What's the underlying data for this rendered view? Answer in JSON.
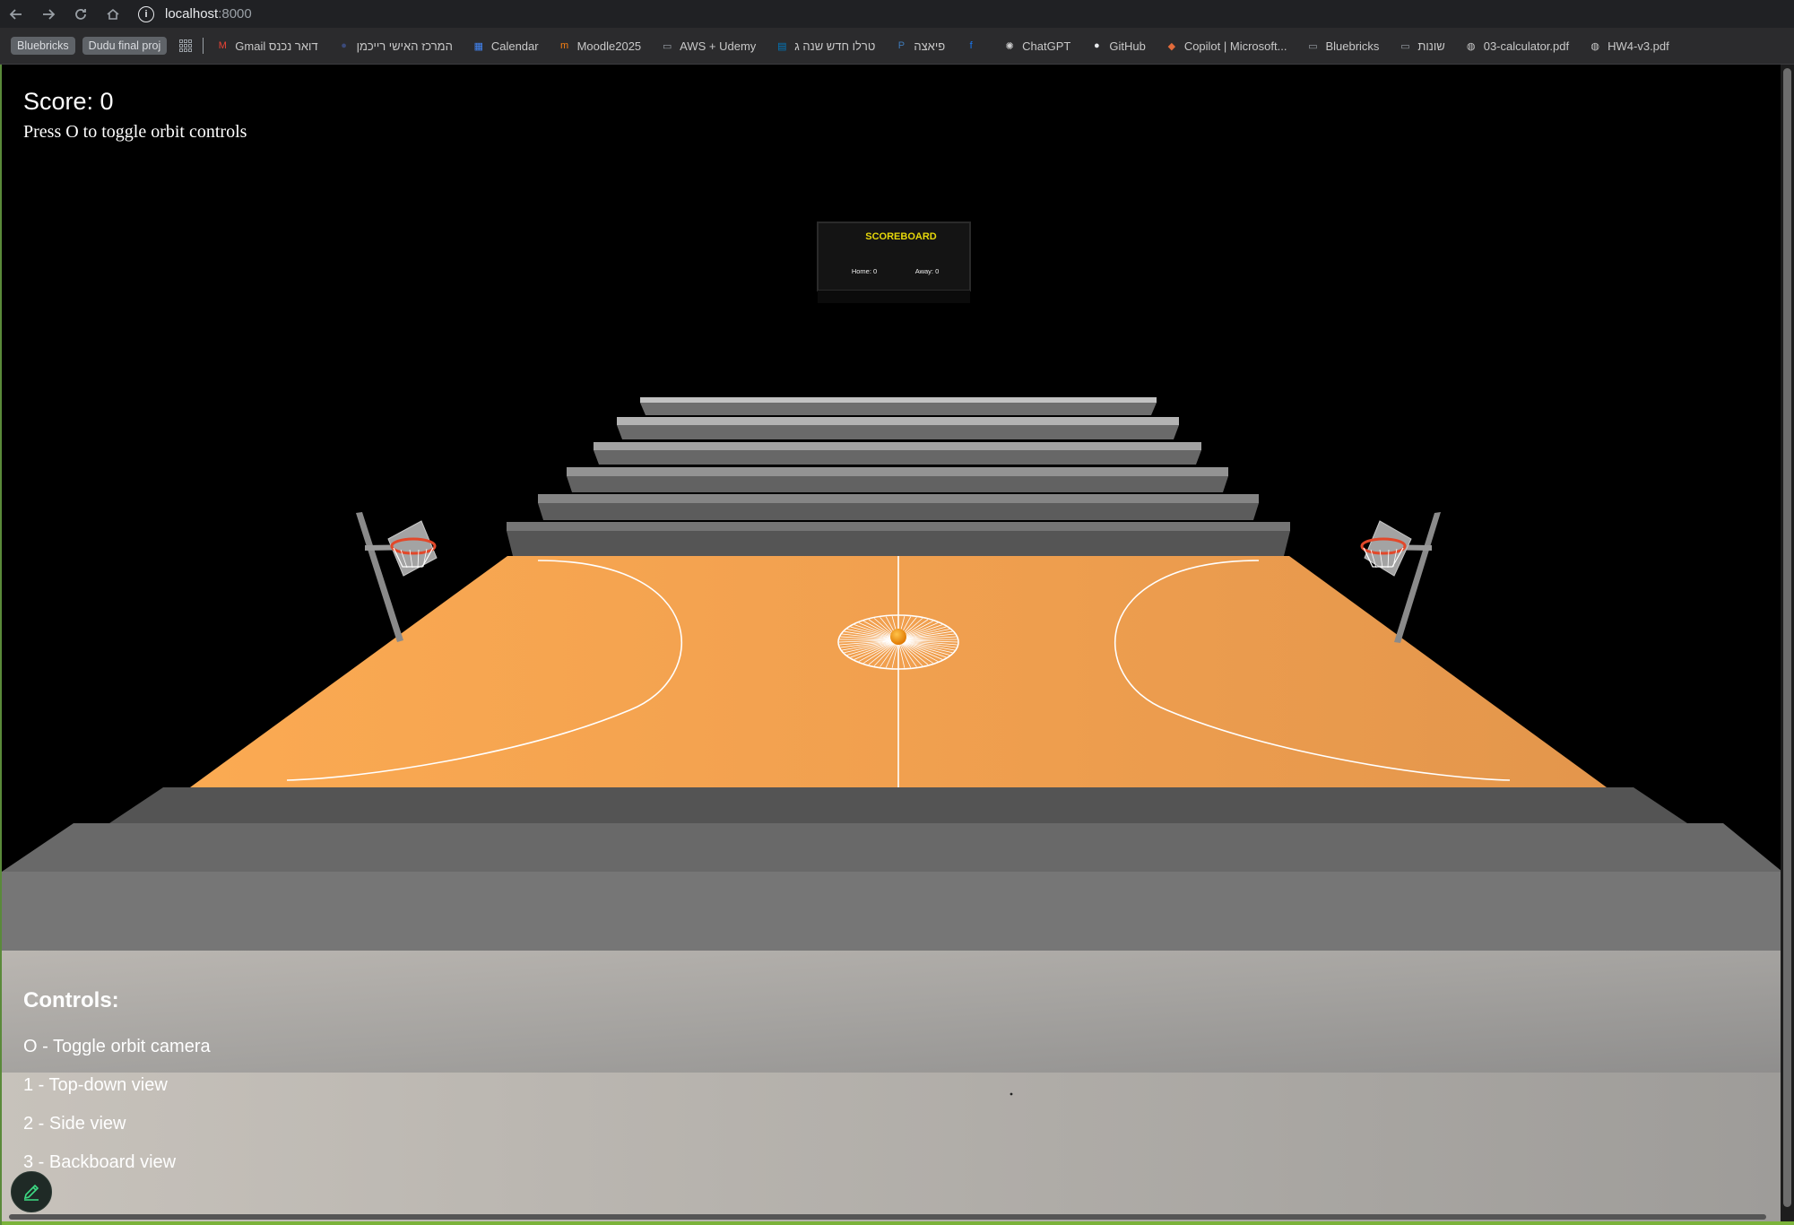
{
  "browser": {
    "url_host": "localhost",
    "url_port": ":8000",
    "bookmarks": [
      {
        "label": "Bluebricks",
        "kind": "chip"
      },
      {
        "label": "Dudu final proj",
        "kind": "chip"
      },
      {
        "label": "Gmail דואר נכנס",
        "icon": "gmail-icon",
        "color": "#ea4335"
      },
      {
        "label": "המרכז האישי רייכמן",
        "icon": "reichman-icon",
        "color": "#3b4a7a"
      },
      {
        "label": "Calendar",
        "icon": "calendar-icon",
        "color": "#4285f4"
      },
      {
        "label": "Moodle2025",
        "icon": "moodle-icon",
        "color": "#f98012"
      },
      {
        "label": "AWS + Udemy",
        "icon": "folder-icon",
        "color": "#9aa0a6"
      },
      {
        "label": "טרלו חדש שנה ג",
        "icon": "trello-icon",
        "color": "#0079bf"
      },
      {
        "label": "פיאצה",
        "icon": "piazza-icon",
        "color": "#3e7ab8"
      },
      {
        "label": "",
        "icon": "facebook-icon",
        "color": "#1877f2"
      },
      {
        "label": "ChatGPT",
        "icon": "chatgpt-icon",
        "color": "#cfcfcf"
      },
      {
        "label": "GitHub",
        "icon": "github-icon",
        "color": "#e8eaed"
      },
      {
        "label": "Copilot | Microsoft...",
        "icon": "copilot-icon",
        "color": "#e26b3b"
      },
      {
        "label": "Bluebricks",
        "icon": "folder-icon",
        "color": "#9aa0a6"
      },
      {
        "label": "שונות",
        "icon": "folder-icon",
        "color": "#9aa0a6"
      },
      {
        "label": "03-calculator.pdf",
        "icon": "globe-icon",
        "color": "#c8c8c8"
      },
      {
        "label": "HW4-v3.pdf",
        "icon": "globe-icon",
        "color": "#c8c8c8"
      }
    ]
  },
  "hud": {
    "score": "Score: 0",
    "hint": "Press O to toggle orbit controls"
  },
  "scoreboard": {
    "title": "SCOREBOARD",
    "home": "Home: 0",
    "away": "Away: 0",
    "title_color": "#e6d70a"
  },
  "controls": {
    "heading": "Controls:",
    "lines": [
      "O - Toggle orbit camera",
      "1 - Top-down view",
      "2 - Side view",
      "3 - Backboard view"
    ]
  },
  "colors": {
    "court": "#f5a04e",
    "court_lines": "#ffffff",
    "ball": "#ff8c00",
    "rim": "#e2482a",
    "background": "#000000"
  }
}
